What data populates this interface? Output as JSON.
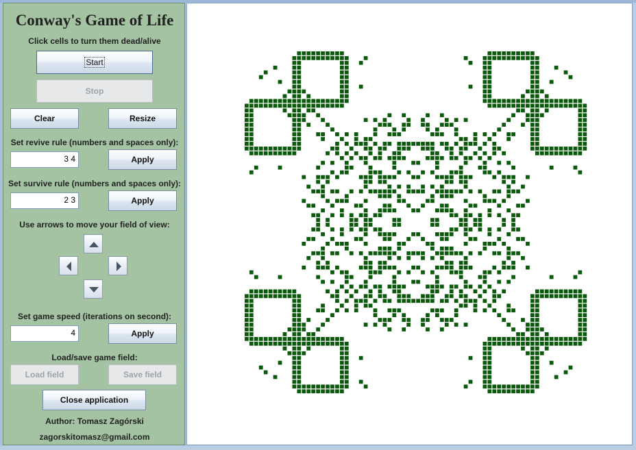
{
  "app": {
    "title": "Conway's Game of Life",
    "hint": "Click cells to turn them dead/alive"
  },
  "controls": {
    "start_label": "Start",
    "stop_label": "Stop",
    "clear_label": "Clear",
    "resize_label": "Resize",
    "revive_label": "Set revive rule (numbers and spaces only):",
    "revive_value": "3 4",
    "survive_label": "Set survive rule (numbers and spaces only):",
    "survive_value": "2 3",
    "apply_label": "Apply",
    "arrows_label": "Use arrows to move your field of view:",
    "speed_label": "Set game speed (iterations on second):",
    "speed_value": "4",
    "loadsave_label": "Load/save game field:",
    "load_label": "Load field",
    "save_label": "Save field",
    "close_label": "Close application"
  },
  "footer": {
    "author": "Author: Tomasz Zagórski",
    "email": "zagorskitomasz@gmail.com"
  },
  "colors": {
    "panel": "#a4c3a2",
    "cell_alive": "#0b5a0b",
    "canvas": "#ffffff"
  },
  "icons": [
    "arrow-up-icon",
    "arrow-left-icon",
    "arrow-right-icon",
    "arrow-down-icon"
  ]
}
